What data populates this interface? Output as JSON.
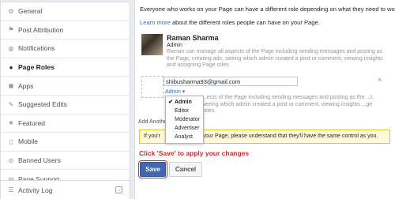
{
  "sidebar": {
    "items": [
      {
        "label": "General",
        "icon": "gear-icon"
      },
      {
        "label": "Post Attribution",
        "icon": "flag-icon"
      },
      {
        "label": "Notifications",
        "icon": "globe-icon"
      },
      {
        "label": "Page Roles",
        "icon": "user-icon",
        "active": true
      },
      {
        "label": "Apps",
        "icon": "box-icon"
      },
      {
        "label": "Suggested Edits",
        "icon": "pencil-icon"
      },
      {
        "label": "Featured",
        "icon": "star-icon"
      },
      {
        "label": "Mobile",
        "icon": "mobile-icon"
      },
      {
        "label": "Banned Users",
        "icon": "ban-icon"
      },
      {
        "label": "Page Support",
        "icon": "support-icon"
      }
    ],
    "activity_log": {
      "label": "Activity Log",
      "icon": "list-icon"
    }
  },
  "main": {
    "intro": "Everyone who works on your Page can have a different role depending on what they need to work on.",
    "learn_link": "Learn more",
    "learn_rest": " about the different roles people can have on your Page.",
    "admin": {
      "name": "Raman Sharma",
      "role": "Admin",
      "description": "Raman can manage all aspects of the Page including sending messages and posting as the Page, creating ads, seeing which admin created a post or comment, viewing insights and assigning Page roles."
    },
    "new_role": {
      "email_value": "shibusharma93@gmail.com",
      "remove": "×",
      "role_label": "Admin ▾",
      "description": "...ects of the Page including sending messages and posting as the ...t, seeing which admin created a post or comment, viewing insights ...ge roles."
    },
    "dropdown": {
      "options": [
        "Admin",
        "Editor",
        "Moderator",
        "Advertiser",
        "Analyst"
      ],
      "selected_check": "✔"
    },
    "add_another": "Add Anothe",
    "warning": {
      "left": "If you'r",
      "right": "n to your Page, please understand that they'll have the same control as you."
    },
    "annotation": "Click 'Save' to apply your changes",
    "buttons": {
      "save": "Save",
      "cancel": "Cancel"
    }
  }
}
